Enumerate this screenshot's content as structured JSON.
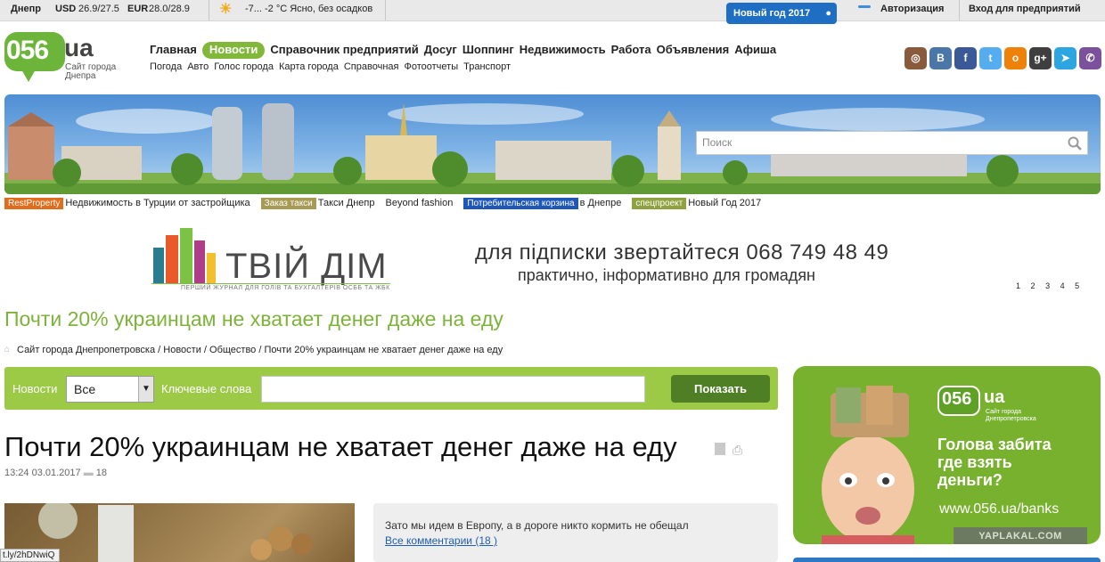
{
  "topbar": {
    "city": "Днепр",
    "usd_label": "USD",
    "usd_value": "26.9/27.5",
    "eur_label": "EUR",
    "eur_value": "28.0/28.9",
    "weather": "-7... -2 °C Ясно, без осадков",
    "new_year": "Новый год 2017",
    "login": "Авторизация",
    "enterprise_login": "Вход для предприятий"
  },
  "logo": {
    "number": "056",
    "domain": "ua",
    "tagline_line1": "Сайт города",
    "tagline_line2": "Днепра"
  },
  "nav": {
    "main": [
      "Главная",
      "Новости",
      "Справочник предприятий",
      "Досуг",
      "Шоппинг",
      "Недвижимость",
      "Работа",
      "Объявления",
      "Афиша"
    ],
    "active": "Новости",
    "sub": [
      "Погода",
      "Авто",
      "Голос города",
      "Карта города",
      "Справочная",
      "Фотоотчеты",
      "Транспорт"
    ]
  },
  "social": [
    {
      "icon": "instagram-icon",
      "glyph": "◎",
      "color": "#8a5a3c"
    },
    {
      "icon": "vk-icon",
      "glyph": "B",
      "color": "#4a76a8"
    },
    {
      "icon": "facebook-icon",
      "glyph": "f",
      "color": "#3b5998"
    },
    {
      "icon": "twitter-icon",
      "glyph": "t",
      "color": "#55acee"
    },
    {
      "icon": "odnoklassniki-icon",
      "glyph": "o",
      "color": "#ee8208"
    },
    {
      "icon": "google-plus-icon",
      "glyph": "g+",
      "color": "#3f3f3f"
    },
    {
      "icon": "telegram-icon",
      "glyph": "➤",
      "color": "#2ca5e0"
    },
    {
      "icon": "viber-icon",
      "glyph": "✆",
      "color": "#7b519d"
    }
  ],
  "search": {
    "placeholder": "Поиск"
  },
  "promo": [
    {
      "tag": "RestProperty",
      "tag_color": "#e06c1c",
      "text": "Недвижимость в Турции от застройщика"
    },
    {
      "tag": "Заказ такси",
      "tag_color": "#a79a55",
      "text": "Такси Днепр"
    },
    {
      "tag": "",
      "tag_color": "",
      "text": "Beyond fashion"
    },
    {
      "tag": "Потребительская корзина",
      "tag_color": "#1e57b8",
      "text": "в Днепре"
    },
    {
      "tag": "спецпроект",
      "tag_color": "#8ea240",
      "text": "Новый Год 2017"
    }
  ],
  "ad": {
    "brand": "ТВІЙ ДІМ",
    "brand_sub": "ПЕРШИЙ ЖУРНАЛ ДЛЯ ГОЛІВ ТА БУХГАЛТЕРІВ ОСББ ТА ЖБК",
    "phone_line": "для підписки звертайтеся 068 749 48 49",
    "tagline": "практично, інформативно для громадян",
    "pages": [
      "1",
      "2",
      "3",
      "4",
      "5"
    ]
  },
  "page_heading": "Почти 20% украинцам не хватает денег даже на еду",
  "breadcrumb": "Сайт города Днепропетровска / Новости / Общество / Почти 20% украинцам не хватает денег даже на еду",
  "filter": {
    "news_label": "Новости",
    "select_value": "Все",
    "keywords_label": "Ключевые слова",
    "keywords_value": "",
    "show_button": "Показать"
  },
  "article": {
    "title": "Почти 20% украинцам не хватает денег даже на еду",
    "time": "13:24",
    "date": "03.01.2017",
    "comments_count": "18"
  },
  "comment_box": {
    "text": "Зато мы идем в Европу, а в дороге никто кормить не обещал",
    "link": "Все комментарии (18 )"
  },
  "side_ad": {
    "logo_number": "056",
    "logo_domain": "ua",
    "logo_sub_line1": "Сайт города",
    "logo_sub_line2": "Днепропетровска",
    "line1": "Голова забита",
    "line2": "где взять",
    "line3": "деньги?",
    "url": "www.056.ua/banks",
    "watermark": "YAPLAKAL.COM"
  },
  "status_url": "t.ly/2hDNwiQ"
}
